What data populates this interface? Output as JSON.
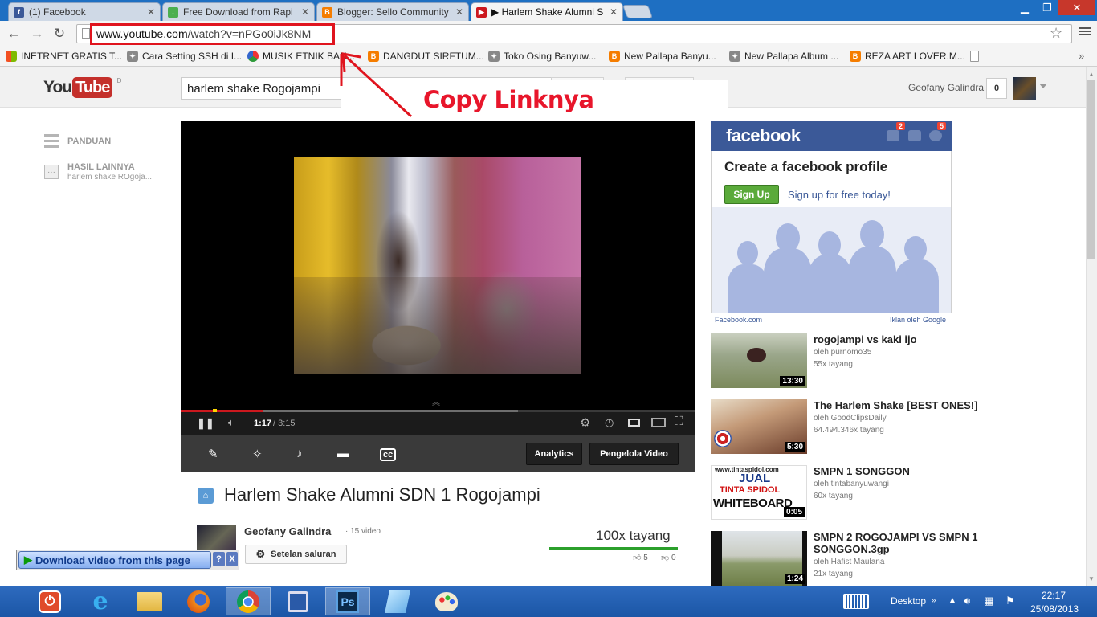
{
  "browser": {
    "tabs": [
      {
        "title": "(1) Facebook",
        "icon": "facebook-icon",
        "color": "#3b5998"
      },
      {
        "title": "Free Download from Rapi",
        "icon": "download-arrow-icon",
        "color": "#4caf50"
      },
      {
        "title": "Blogger: Sello Community",
        "icon": "blogger-icon",
        "color": "#f57d00"
      },
      {
        "title": "▶ Harlem Shake Alumni S",
        "icon": "youtube-icon",
        "color": "#cc181e"
      }
    ],
    "url_host": "www.youtube.com",
    "url_path": "/watch?v=nPGo0iJk8NM",
    "bookmarks": [
      {
        "label": "INETRNET GRATIS T...",
        "icon": "windows-flag-icon",
        "color": "#f25022"
      },
      {
        "label": "Cara Setting SSH di I...",
        "icon": "puzzle-icon",
        "color": "#777777"
      },
      {
        "label": "MUSIK ETNIK BAN...",
        "icon": "picasa-icon",
        "color": "#2e9a3a"
      },
      {
        "label": "DANGDUT SIRFTUM...",
        "icon": "blogger-icon",
        "color": "#f57d00"
      },
      {
        "label": "Toko Osing Banyuw...",
        "icon": "puzzle-icon",
        "color": "#777777"
      },
      {
        "label": "New Pallapa Banyu...",
        "icon": "blogger-icon",
        "color": "#f57d00"
      },
      {
        "label": "New Pallapa Album ...",
        "icon": "puzzle-icon",
        "color": "#777777"
      },
      {
        "label": "REZA ART LOVER.M...",
        "icon": "blogger-icon",
        "color": "#f57d00"
      }
    ]
  },
  "youtube": {
    "logo_you": "You",
    "logo_tube": "Tube",
    "country": "ID",
    "search_query": "harlem shake Rogojampi",
    "user_name": "Geofany Galindra",
    "notifications": "0",
    "guide": {
      "panduan": "PANDUAN",
      "hasil": "HASIL LAINNYA",
      "hasil_sub": "harlem shake ROgoja..."
    },
    "player": {
      "time_current": "1:17",
      "time_total": "/ 3:15",
      "progress_fraction": 0.4,
      "analytics_label": "Analytics",
      "manager_label": "Pengelola Video"
    },
    "video": {
      "title": "Harlem Shake Alumni SDN 1 Rogojampi",
      "channel": "Geofany Galindra",
      "channel_count": "· 15 video",
      "settings_label": "Setelan saluran",
      "views": "100x tayang",
      "likes": "5",
      "dislikes": "0"
    },
    "ad": {
      "brand": "facebook",
      "badge1": "2",
      "badge2": "5",
      "headline": "Create a facebook profile",
      "signup_btn": "Sign Up",
      "signup_text": "Sign up for free today!",
      "footer_left": "Facebook.com",
      "footer_right": "Iklan oleh Google"
    },
    "related": [
      {
        "title": "rogojampi vs kaki ijo",
        "by": "oleh purnomo35",
        "views": "55x tayang",
        "duration": "13:30"
      },
      {
        "title": "The Harlem Shake [BEST ONES!]",
        "by": "oleh GoodClipsDaily",
        "views": "64.494.346x tayang",
        "duration": "5:30"
      },
      {
        "title": "SMPN 1 SONGGON",
        "by": "oleh tintabanyuwangi",
        "views": "60x tayang",
        "duration": "0:05",
        "thumb_lines": [
          "www.tintaspidol.com",
          "JUAL",
          "TINTA SPIDOL",
          "WHITEBOARD"
        ]
      },
      {
        "title": "SMPN 2 ROGOJAMPI VS SMPN 1 SONGGON.3gp",
        "by": "oleh Hafist Maulana",
        "views": "21x tayang",
        "duration": "1:24"
      }
    ]
  },
  "annotation": {
    "text": "Copy Linknya",
    "color": "#e8162b"
  },
  "download_bar": {
    "label": "Download video from this page",
    "help": "?",
    "close": "X"
  },
  "taskbar": {
    "apps": [
      "power-icon",
      "internet-explorer-icon",
      "file-explorer-icon",
      "firefox-icon",
      "chrome-icon",
      "app-frame-icon",
      "photoshop-icon",
      "notepad-icon",
      "paint-icon"
    ],
    "desktop_label": "Desktop",
    "time": "22:17",
    "date": "25/08/2013"
  }
}
